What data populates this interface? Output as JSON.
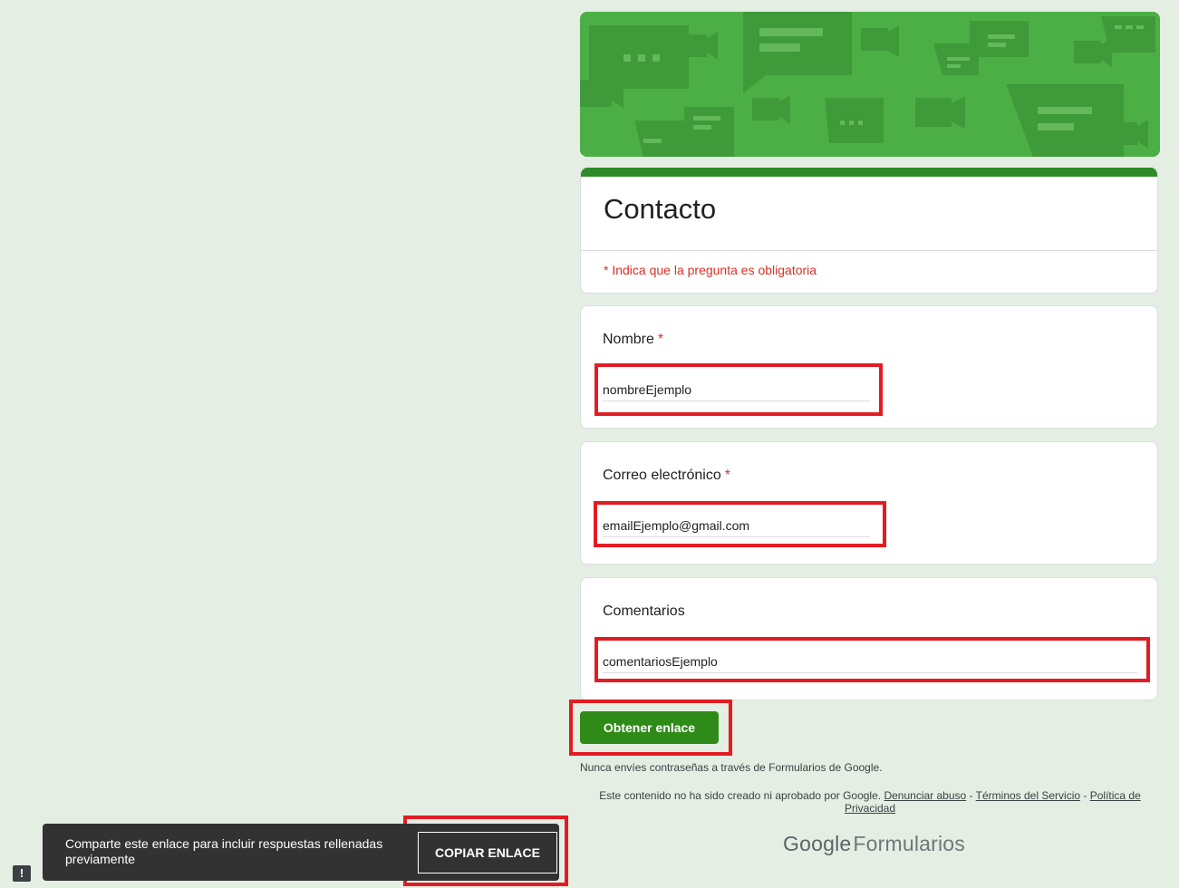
{
  "form": {
    "title": "Contacto",
    "required_note": "* Indica que la pregunta es obligatoria"
  },
  "questions": [
    {
      "label": "Nombre",
      "required": "*",
      "value": "nombreEjemplo"
    },
    {
      "label": "Correo electrónico",
      "required": "*",
      "value": "emailEjemplo@gmail.com"
    },
    {
      "label": "Comentarios",
      "value": "comentariosEjemplo"
    }
  ],
  "submit_label": "Obtener enlace",
  "footer": {
    "password_warning": "Nunca envíes contraseñas a través de Formularios de Google.",
    "disclaimer": "Este contenido no ha sido creado ni aprobado por Google.",
    "link_abuse": "Denunciar abuso",
    "link_terms": "Términos del Servicio",
    "link_privacy": "Política de Privacidad",
    "separator": "-",
    "brand_google": "Google",
    "brand_forms": "Formularios"
  },
  "snackbar": {
    "message": "Comparte este enlace para incluir respuestas rellenadas previamente",
    "action_label": "COPIAR ENLACE"
  },
  "report_icon": "!",
  "colors": {
    "page_bg": "#e4eee3",
    "accent": "#2e8b17",
    "required": "#d93025",
    "highlight": "#e31b23",
    "banner": "#4caf45"
  },
  "icons": [
    "chat-bubble-icon",
    "video-camera-icon",
    "feedback-icon"
  ]
}
